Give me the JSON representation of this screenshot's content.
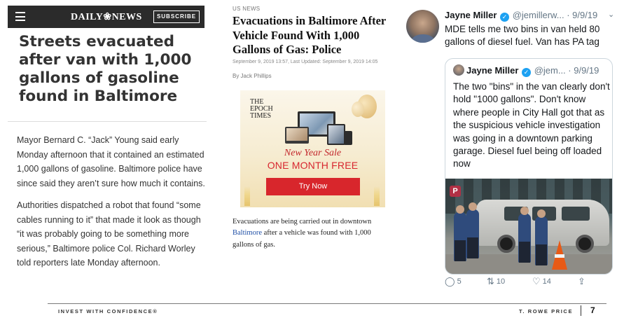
{
  "daily_news": {
    "logo": "DAILY❀NEWS",
    "subscribe_label": "SUBSCRIBE",
    "headline": "Streets evacuated after van with 1,000 gallons of gasoline found in Baltimore",
    "paragraphs": [
      "Mayor Bernard C. “Jack” Young said early Monday afternoon that it contained an estimated 1,000 gallons of gasoline. Baltimore police have since said they aren’t sure how much it contains.",
      "Authorities dispatched a robot that found “some cables running to it” that made it look as though “it was probably going to be something more serious,” Baltimore police Col. Richard Worley told reporters late Monday afternoon."
    ]
  },
  "epoch_times": {
    "kicker": "US NEWS",
    "headline": "Evacuations in Baltimore After Vehicle Found With 1,000 Gallons of Gas: Police",
    "meta": "September 9, 2019 13:57, Last Updated: September 9, 2019 14:05",
    "byline": "By Jack Phillips",
    "ad": {
      "logo_line1": "THE",
      "logo_line2": "EPOCH",
      "logo_line3": "TIMES",
      "sale": "New Year Sale",
      "offer": "ONE MONTH FREE",
      "button": "Try Now"
    },
    "body_before_link": "Evacuations are being carried out in downtown ",
    "body_link": "Baltimore",
    "body_after_link": " after a vehicle was found with 1,000 gallons of gas."
  },
  "tweet": {
    "name": "Jayne Miller",
    "handle": "@jemillerw...",
    "date": "· 9/9/19",
    "text": "MDE tells me two bins in van held 80 gallons of diesel fuel. Van has PA tag",
    "quoted": {
      "name": "Jayne Miller",
      "handle": "@jem...",
      "date": "· 9/9/19",
      "text": "The two \"bins\" in the van clearly don't hold \"1000 gallons\". Don't know where people in City Hall got that as the suspicious vehicle investigation was going in a downtown parking garage. Diesel fuel being off loaded now",
      "photo_sign": "P"
    },
    "replies": "5",
    "retweets": "10",
    "likes": "14"
  },
  "footer": {
    "left": "INVEST WITH CONFIDENCE®",
    "right": "T. ROWE PRICE",
    "page": "7"
  },
  "colors": {
    "verified": "#1da1f2",
    "ad_red": "#d8262c",
    "link_blue": "#1f4fa6"
  }
}
